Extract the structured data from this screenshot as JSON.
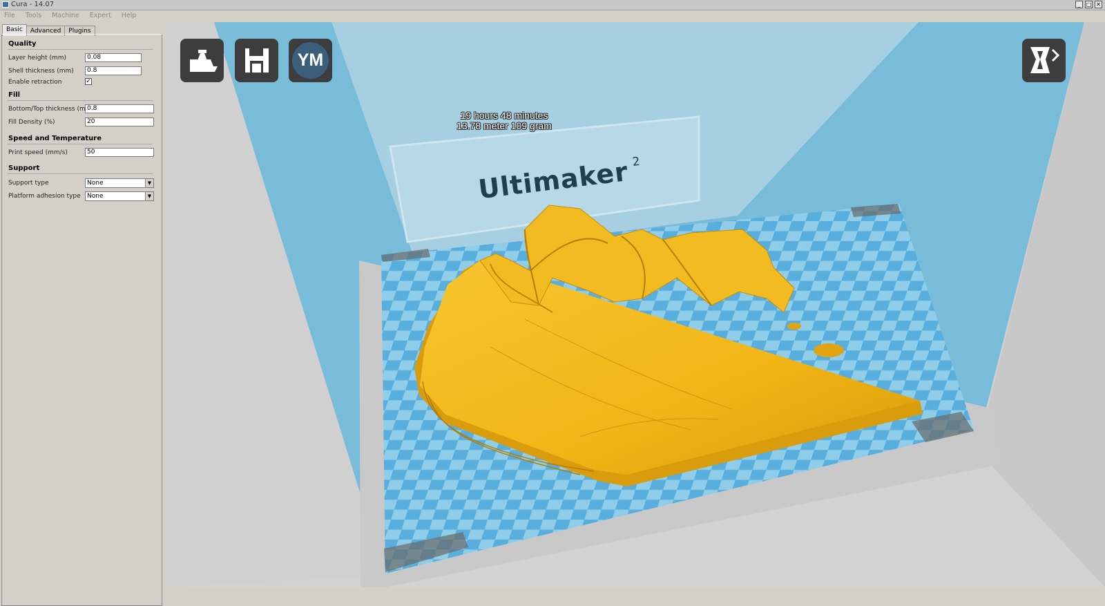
{
  "window": {
    "title": "Cura - 14.07",
    "controls": [
      "minimize-icon",
      "restore-icon",
      "close-icon"
    ]
  },
  "menu": [
    "File",
    "Tools",
    "Machine",
    "Expert",
    "Help"
  ],
  "tabs": [
    "Basic",
    "Advanced",
    "Plugins"
  ],
  "sections": {
    "quality": {
      "title": "Quality",
      "layer_height": {
        "label": "Layer height (mm)",
        "value": "0.08"
      },
      "shell_thickness": {
        "label": "Shell thickness (mm)",
        "value": "0.8"
      },
      "retraction": {
        "label": "Enable retraction",
        "checked": "✓"
      }
    },
    "fill": {
      "title": "Fill",
      "bottom_top": {
        "label": "Bottom/Top thickness (mm)",
        "value": "0.8"
      },
      "density": {
        "label": "Fill Density (%)",
        "value": "20"
      }
    },
    "speed": {
      "title": "Speed and Temperature",
      "print_speed": {
        "label": "Print speed (mm/s)",
        "value": "50"
      }
    },
    "support": {
      "title": "Support",
      "support_type": {
        "label": "Support type",
        "value": "None"
      },
      "adhesion": {
        "label": "Platform adhesion type",
        "value": "None"
      }
    }
  },
  "viewport": {
    "brand": "Ultimaker",
    "brand_sup": "2",
    "buttons": {
      "load": "load-icon",
      "save": "save-icon",
      "account": "YM",
      "view_mode": "view-mode-icon"
    },
    "print_time": "19 hours 48 minutes",
    "print_material": "13.78 meter 109 gram"
  },
  "colors": {
    "model": "#f2b619",
    "build_volume": "#6cbde0",
    "bed_light": "#8fcde8",
    "bed_dark": "#58aedc",
    "button_bg": "#3d3d3d",
    "avatar": "#3b5f7a"
  }
}
